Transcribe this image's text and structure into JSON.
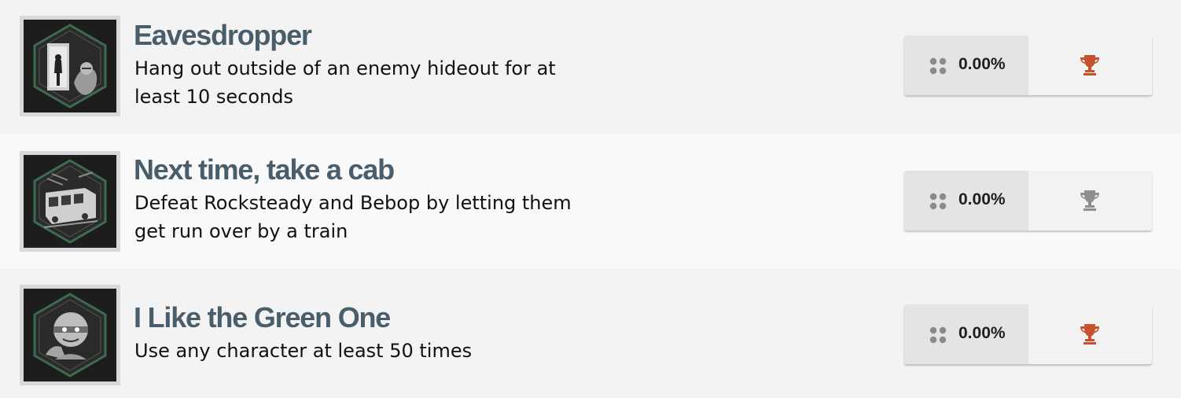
{
  "achievements": [
    {
      "title": "Eavesdropper",
      "description": "Hang out outside of an enemy hideout for at least 10 seconds",
      "percent": "0.00%",
      "trophy": "bronze-trophy-icon",
      "trophy_color": "#c6512d",
      "art": "eavesdropper-art"
    },
    {
      "title": "Next time, take a cab",
      "description": "Defeat Rocksteady and Bebop by letting them get run over by a train",
      "percent": "0.00%",
      "trophy": "silver-trophy-icon",
      "trophy_color": "#8e8e8e",
      "art": "train-art"
    },
    {
      "title": "I Like the Green One",
      "description": "Use any character at least 50 times",
      "percent": "0.00%",
      "trophy": "bronze-trophy-icon",
      "trophy_color": "#c6512d",
      "art": "turtle-art"
    }
  ],
  "colors": {
    "title": "#4a5d6b",
    "badge_border": "#3d6b4f",
    "badge_bg": "#1d1d1d"
  }
}
